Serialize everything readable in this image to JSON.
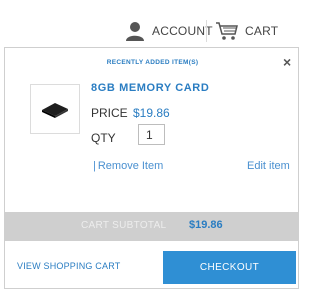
{
  "header": {
    "account_label": "ACCOUNT",
    "account_icon": "user-icon",
    "cart_label": "CART",
    "cart_icon": "shopping-cart-icon"
  },
  "minicart": {
    "recent_label": "RECENTLY ADDED ITEM(S)",
    "close_label": "×",
    "item": {
      "name": "8GB MEMORY CARD",
      "price_label": "PRICE",
      "price": "$19.86",
      "qty_label": "QTY",
      "qty": "1",
      "remove_label": "Remove Item",
      "edit_label": "Edit item"
    },
    "subtotal_label": "CART SUBTOTAL",
    "subtotal_value": "$19.86",
    "view_cart_label": "VIEW SHOPPING CART",
    "checkout_label": "CHECKOUT"
  },
  "colors": {
    "accent": "#2a7dc2",
    "checkout_bg": "#2f8fd4",
    "subtotal_bg": "#cfcfcf"
  }
}
